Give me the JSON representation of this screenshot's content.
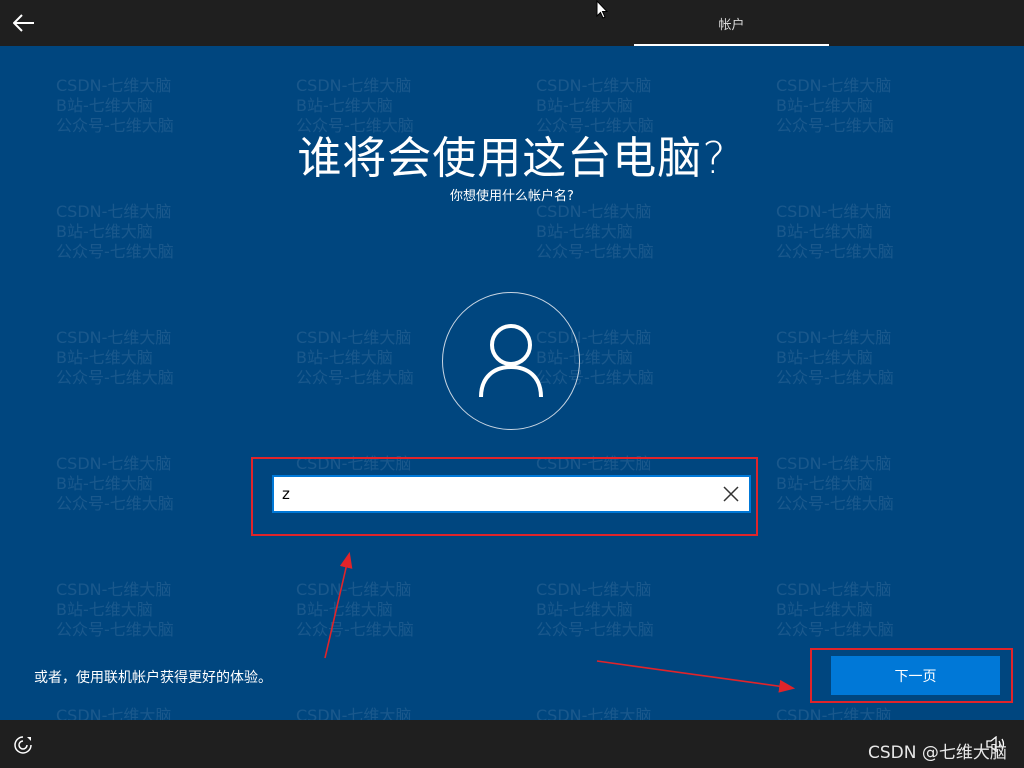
{
  "topbar": {
    "back_icon": "arrow-left-icon",
    "tab_label": "帐户"
  },
  "watermark": {
    "line1": "CSDN-七维大脑",
    "line2": "B站-七维大脑",
    "line3": "公众号-七维大脑"
  },
  "main": {
    "title": "谁将会使用这台电脑?",
    "subtitle": "你想使用什么帐户名?",
    "avatar_icon": "user-icon",
    "name_input": {
      "value": "z"
    },
    "clear_icon": "close-icon",
    "online_account_link": "或者，使用联机帐户获得更好的体验。",
    "next_button": "下一页"
  },
  "bottombar": {
    "ease_icon": "ease-of-access-icon",
    "volume_icon": "speaker-icon",
    "csdn_watermark": "CSDN @七维大脑"
  },
  "colors": {
    "background": "#00467f",
    "bar": "#1f1f1f",
    "accent": "#0078d7",
    "annotation": "#e0242a"
  }
}
